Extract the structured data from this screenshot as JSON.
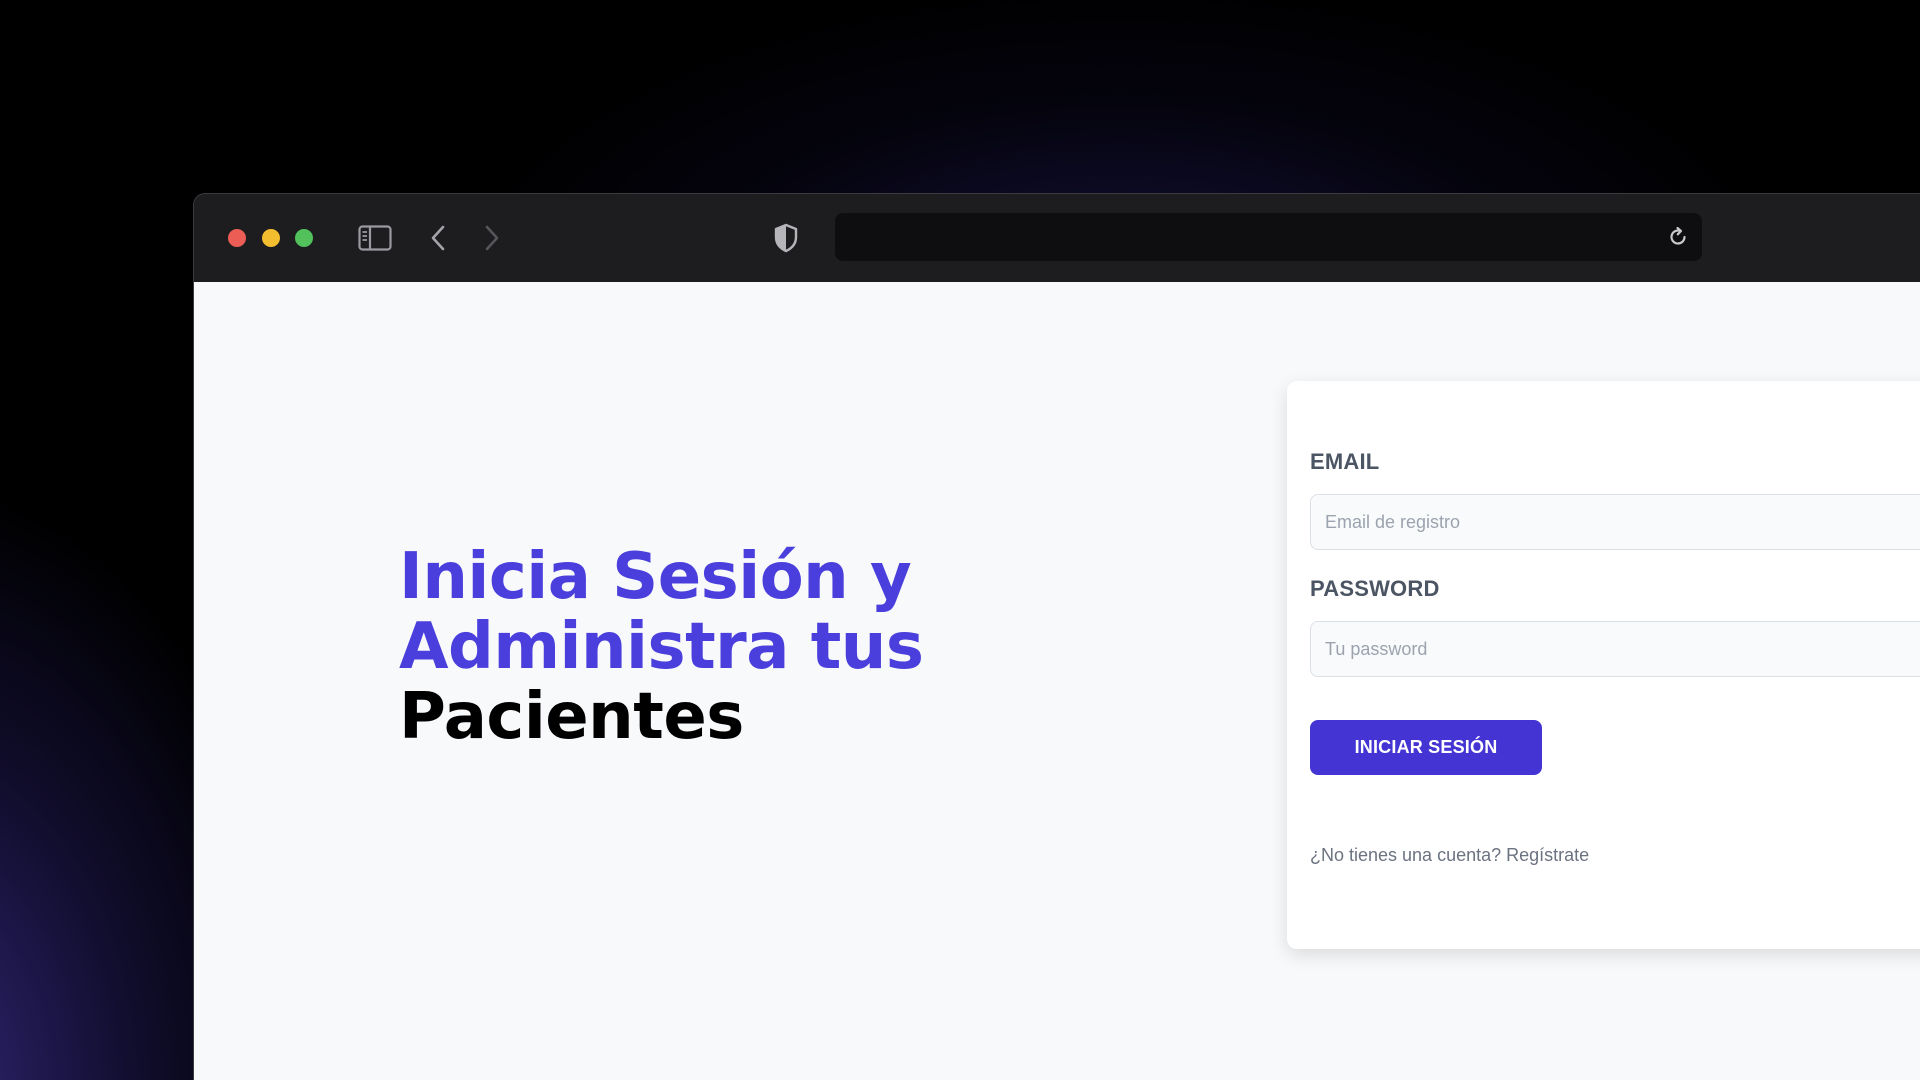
{
  "browser": {
    "url": "",
    "icons": {
      "sidebar": "sidebar-icon",
      "back": "chevron-left-icon",
      "forward": "chevron-right-icon",
      "privacy": "shield-icon",
      "reload": "reload-icon"
    },
    "traffic_lights": [
      "#ec5d55",
      "#f2bd2f",
      "#52c15b"
    ]
  },
  "hero": {
    "line1": "Inicia Sesión y",
    "line2": "Administra tus",
    "line3": "Pacientes"
  },
  "login": {
    "email_label": "EMAIL",
    "email_placeholder": "Email de registro",
    "password_label": "PASSWORD",
    "password_placeholder": "Tu password",
    "submit_label": "INICIAR SESIÓN",
    "register_link": "¿No tienes una cuenta? Regístrate"
  },
  "colors": {
    "accent": "#4a3fdc",
    "button": "#4434d4",
    "page_bg": "#f8f9fb"
  }
}
